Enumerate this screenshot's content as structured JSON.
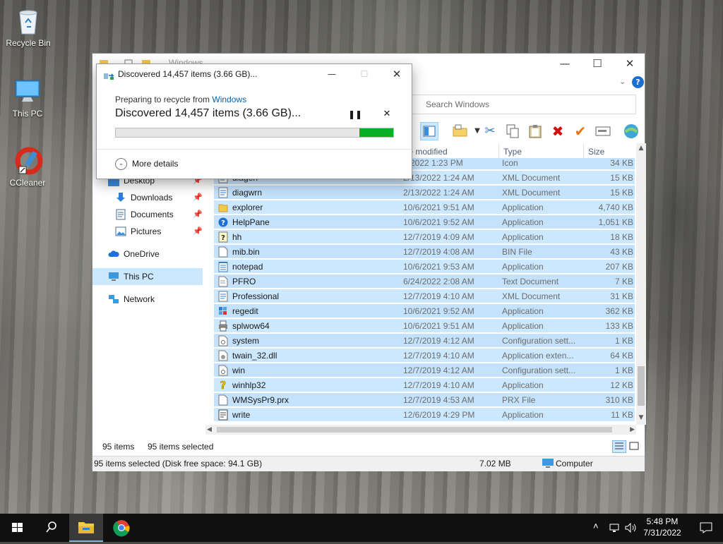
{
  "desktop": {
    "icons": [
      {
        "label": "Recycle Bin"
      },
      {
        "label": "This PC"
      },
      {
        "label": "CCleaner"
      }
    ]
  },
  "explorer": {
    "title": "Windows",
    "search_placeholder": "Search Windows",
    "columns": [
      "te modified",
      "Type",
      "Size"
    ],
    "nav": [
      {
        "label": "Desktop",
        "pinned": true
      },
      {
        "label": "Downloads",
        "pinned": true
      },
      {
        "label": "Documents",
        "pinned": true
      },
      {
        "label": "Pictures",
        "pinned": true
      },
      {
        "label": "OneDrive",
        "pinned": false
      },
      {
        "label": "This PC",
        "pinned": false
      },
      {
        "label": "Network",
        "pinned": false
      }
    ],
    "files": [
      {
        "name": "",
        "modified": "2/2022 1:23 PM",
        "type": "Icon",
        "size": "34 KB",
        "icon": "icon-file"
      },
      {
        "name": "diagerr",
        "modified": "2/13/2022 1:24 AM",
        "type": "XML Document",
        "size": "15 KB",
        "icon": "xml-icon"
      },
      {
        "name": "diagwrn",
        "modified": "2/13/2022 1:24 AM",
        "type": "XML Document",
        "size": "15 KB",
        "icon": "xml-icon"
      },
      {
        "name": "explorer",
        "modified": "10/6/2021 9:51 AM",
        "type": "Application",
        "size": "4,740 KB",
        "icon": "folder-app-icon"
      },
      {
        "name": "HelpPane",
        "modified": "10/6/2021 9:52 AM",
        "type": "Application",
        "size": "1,051 KB",
        "icon": "help-icon"
      },
      {
        "name": "hh",
        "modified": "12/7/2019 4:09 AM",
        "type": "Application",
        "size": "18 KB",
        "icon": "help-doc-icon"
      },
      {
        "name": "mib.bin",
        "modified": "12/7/2019 4:08 AM",
        "type": "BIN File",
        "size": "43 KB",
        "icon": "file-icon"
      },
      {
        "name": "notepad",
        "modified": "10/6/2021 9:53 AM",
        "type": "Application",
        "size": "207 KB",
        "icon": "notepad-icon"
      },
      {
        "name": "PFRO",
        "modified": "6/24/2022 2:08 AM",
        "type": "Text Document",
        "size": "7 KB",
        "icon": "text-file-icon"
      },
      {
        "name": "Professional",
        "modified": "12/7/2019 4:10 AM",
        "type": "XML Document",
        "size": "31 KB",
        "icon": "xml-icon"
      },
      {
        "name": "regedit",
        "modified": "10/6/2021 9:52 AM",
        "type": "Application",
        "size": "362 KB",
        "icon": "regedit-icon"
      },
      {
        "name": "splwow64",
        "modified": "10/6/2021 9:51 AM",
        "type": "Application",
        "size": "133 KB",
        "icon": "printer-icon"
      },
      {
        "name": "system",
        "modified": "12/7/2019 4:12 AM",
        "type": "Configuration sett...",
        "size": "1 KB",
        "icon": "config-icon"
      },
      {
        "name": "twain_32.dll",
        "modified": "12/7/2019 4:10 AM",
        "type": "Application exten...",
        "size": "64 KB",
        "icon": "dll-icon"
      },
      {
        "name": "win",
        "modified": "12/7/2019 4:12 AM",
        "type": "Configuration sett...",
        "size": "1 KB",
        "icon": "config-icon"
      },
      {
        "name": "winhlp32",
        "modified": "12/7/2019 4:10 AM",
        "type": "Application",
        "size": "12 KB",
        "icon": "help-yellow-icon"
      },
      {
        "name": "WMSysPr9.prx",
        "modified": "12/7/2019 4:53 AM",
        "type": "PRX File",
        "size": "310 KB",
        "icon": "file-icon"
      },
      {
        "name": "write",
        "modified": "12/6/2019 4:29 PM",
        "type": "Application",
        "size": "11 KB",
        "icon": "write-icon"
      }
    ],
    "status": {
      "items": "95 items",
      "selected": "95 items selected"
    },
    "details": {
      "summary": "95 items selected (Disk free space: 94.1 GB)",
      "size": "7.02 MB",
      "location": "Computer"
    }
  },
  "dialog": {
    "title": "Discovered 14,457 items (3.66 GB)...",
    "preparing_prefix": "Preparing to recycle from ",
    "preparing_link": "Windows",
    "headline": "Discovered 14,457 items (3.66 GB)...",
    "progress": 0.94,
    "more_details": "More details",
    "progress_color": "#06b025"
  },
  "taskbar": {
    "time": "5:48 PM",
    "date": "7/31/2022"
  },
  "colors": {
    "selection": "#cce8ff",
    "link": "#0063b1",
    "delete_red": "#d01010",
    "check_orange": "#e8750a"
  }
}
